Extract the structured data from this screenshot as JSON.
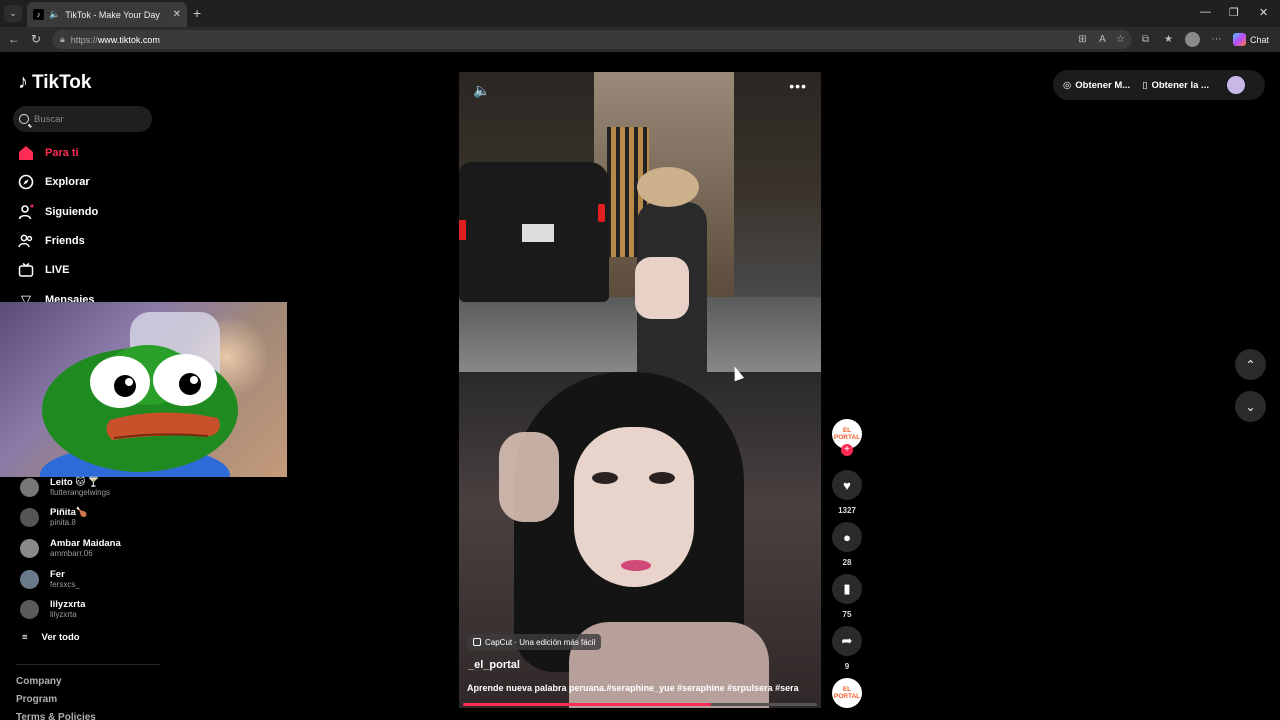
{
  "browser": {
    "tab_title": "TikTok - Make Your Day",
    "url_scheme": "https://",
    "url_host": "www.tiktok.com",
    "chat_label": "Chat"
  },
  "sidebar": {
    "brand": "TikTok",
    "search_placeholder": "Buscar",
    "nav": [
      {
        "label": "Para ti",
        "icon": "home-icon",
        "active": true
      },
      {
        "label": "Explorar",
        "icon": "compass-icon"
      },
      {
        "label": "Siguiendo",
        "icon": "following-icon"
      },
      {
        "label": "Friends",
        "icon": "friends-icon"
      },
      {
        "label": "LIVE",
        "icon": "live-icon"
      },
      {
        "label": "Mensajes",
        "icon": "messages-icon"
      }
    ],
    "following": [
      {
        "name": "Leito 🐱 🍸",
        "handle": "flutterangelwings"
      },
      {
        "name": "Piñita🍗",
        "handle": "pinita.8"
      },
      {
        "name": "Ambar Maidana",
        "handle": "ammbarr.06"
      },
      {
        "name": "Fer",
        "handle": "fersxcs_"
      },
      {
        "name": "lilyzxrta",
        "handle": "lilyzxrta"
      }
    ],
    "see_all": "Ver todo",
    "footer": [
      "Company",
      "Program",
      "Terms & Policies"
    ]
  },
  "video": {
    "capcut": "CapCut · Una edición más fácil",
    "author": "_el_portal",
    "caption": "Aprende nueva palabra peruana.#seraphine_yue #seraphine #srpulsera #sera",
    "progress": 0.7
  },
  "actions": {
    "avatar_text": "EL PORTAL",
    "likes": "1327",
    "comments": "28",
    "saves": "75",
    "shares": "9"
  },
  "topright": {
    "coins": "Obtener M...",
    "app": "Obtener la ..."
  }
}
